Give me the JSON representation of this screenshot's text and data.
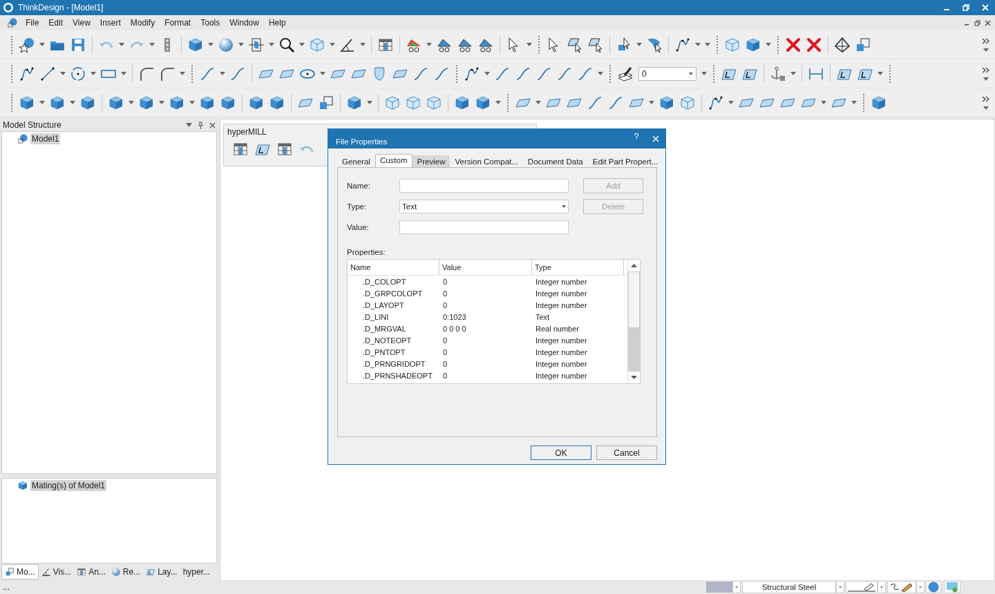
{
  "window": {
    "title": "ThinkDesign  - [Model1]"
  },
  "menu": [
    "File",
    "Edit",
    "View",
    "Insert",
    "Modify",
    "Format",
    "Tools",
    "Window",
    "Help"
  ],
  "toolbar": {
    "layer_combo": "0"
  },
  "model_structure": {
    "title": "Model Structure",
    "items": [
      {
        "label": "Model1",
        "selected": true
      }
    ]
  },
  "matings": {
    "items": [
      {
        "label": "Mating(s) of Model1",
        "selected": true
      }
    ]
  },
  "panel_tabs": [
    {
      "label": "Mo...",
      "selected": true
    },
    {
      "label": "Vis...",
      "selected": false
    },
    {
      "label": "An...",
      "selected": false
    },
    {
      "label": "Re...",
      "selected": false
    },
    {
      "label": "Lay...",
      "selected": false
    },
    {
      "label": "hyper...",
      "selected": false
    }
  ],
  "hypermill": {
    "title": "hyperMILL"
  },
  "dialog": {
    "title": "File Properties",
    "help": "?",
    "tabs": [
      {
        "label": "General",
        "selected": false,
        "highlighted": false
      },
      {
        "label": "Custom",
        "selected": true,
        "highlighted": false
      },
      {
        "label": "Preview",
        "selected": false,
        "highlighted": true
      },
      {
        "label": "Version Compat...",
        "selected": false,
        "highlighted": false
      },
      {
        "label": "Document Data",
        "selected": false,
        "highlighted": false
      },
      {
        "label": "Edit Part Propert...",
        "selected": false,
        "highlighted": false
      }
    ],
    "name_label": "Name:",
    "type_label": "Type:",
    "type_value": "Text",
    "value_label": "Value:",
    "add": {
      "label": "Add",
      "disabled": true
    },
    "delete": {
      "label": "Delete",
      "disabled": true
    },
    "properties_label": "Properties:",
    "table": {
      "columns": [
        "Name",
        "Value",
        "Type"
      ],
      "rows": [
        [
          ".D_COLOPT",
          "0",
          "Integer number"
        ],
        [
          ".D_GRPCOLOPT",
          "0",
          "Integer number"
        ],
        [
          ".D_LAYOPT",
          "0",
          "Integer number"
        ],
        [
          ".D_LINI",
          "0:1023",
          "Text"
        ],
        [
          ".D_MRGVAL",
          "0 0 0 0",
          "Real number"
        ],
        [
          ".D_NOTEOPT",
          "0",
          "Integer number"
        ],
        [
          ".D_PNTOPT",
          "0",
          "Integer number"
        ],
        [
          ".D_PRNGRIDOPT",
          "0",
          "Integer number"
        ],
        [
          ".D_PRNSHADEOPT",
          "0",
          "Integer number"
        ]
      ]
    },
    "ok": "OK",
    "cancel": "Cancel"
  },
  "status_bar": {
    "text": "...",
    "material": "Structural Steel"
  }
}
